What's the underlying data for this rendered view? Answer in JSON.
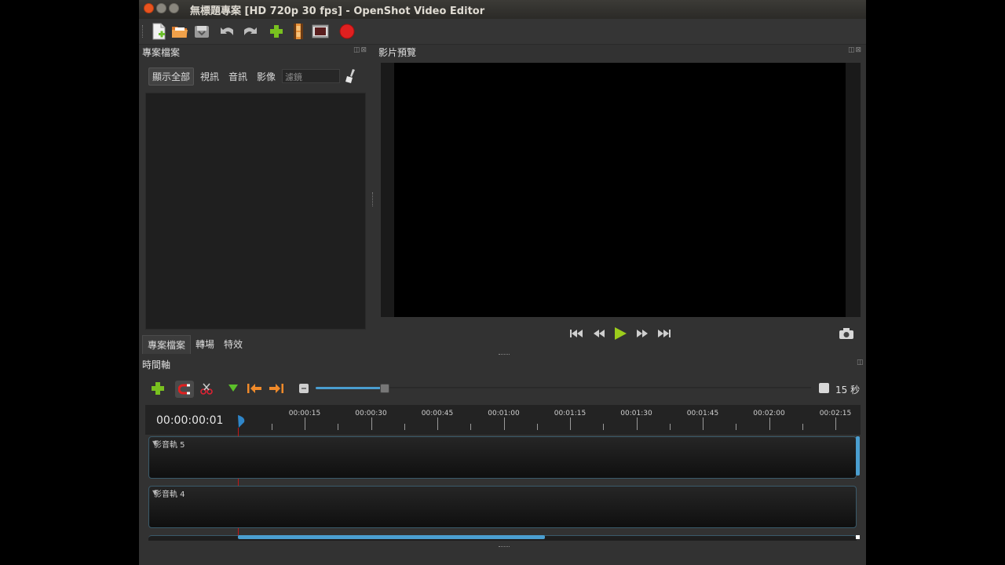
{
  "window": {
    "title": "無標題專案 [HD 720p 30 fps] - OpenShot Video Editor"
  },
  "toolbar": {
    "icons": [
      "new-project-icon",
      "open-project-icon",
      "save-project-icon",
      "undo-icon",
      "redo-icon",
      "import-files-icon",
      "choose-profile-icon",
      "fullscreen-icon",
      "export-video-icon"
    ]
  },
  "project_files": {
    "title": "專案檔案",
    "filters": [
      "顯示全部",
      "視訊",
      "音訊",
      "影像"
    ],
    "filter_placeholder": "濾鏡",
    "bottom_tabs": [
      "專案檔案",
      "轉場",
      "特效"
    ]
  },
  "preview": {
    "title": "影片預覽"
  },
  "timeline": {
    "title": "時間軸",
    "zoom_label": "15 秒",
    "zoom_level": 0.14,
    "current_time": "00:00:00:01",
    "tick_labels": [
      "00:00:15",
      "00:00:30",
      "00:00:45",
      "00:01:00",
      "00:01:15",
      "00:01:30",
      "00:01:45",
      "00:02:00",
      "00:02:15"
    ],
    "tracks": [
      "影音軌 5",
      "影音軌 4"
    ]
  },
  "colors": {
    "accent": "#4a9ed0",
    "playhead": "#c01818",
    "play_button": "#9ccd1c",
    "record": "#e02020"
  }
}
